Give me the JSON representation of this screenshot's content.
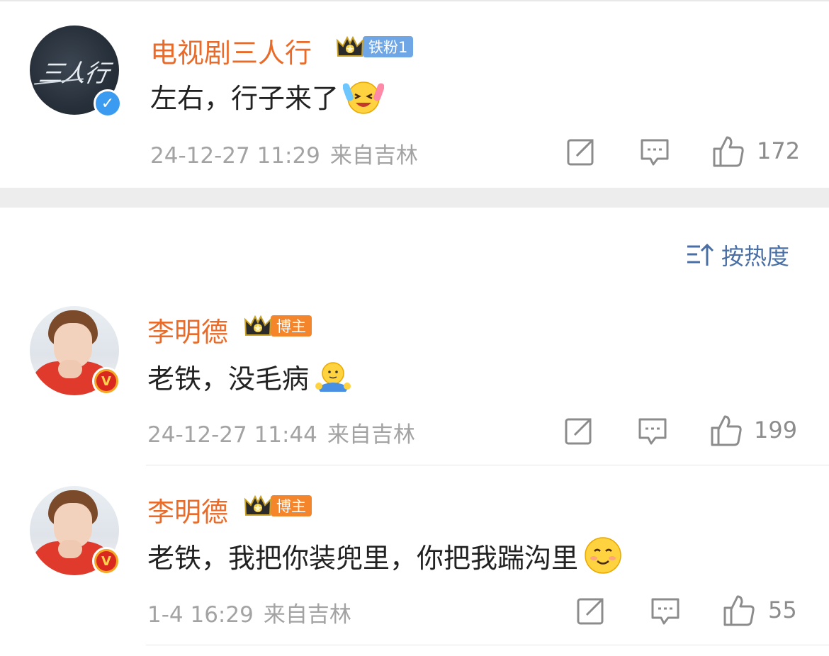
{
  "comments": [
    {
      "name": "电视剧三人行",
      "badge": "铁粉1",
      "avatar_text": "三人行",
      "text": "左右，行子来了",
      "emoji": "laughing-crying-emoji",
      "time": "24-12-27 11:29",
      "source": "来自吉林",
      "likes": "172"
    },
    {
      "name": "李明德",
      "badge": "博主",
      "text": "老铁，没毛病",
      "emoji": "hug-emoji",
      "time": "24-12-27 11:44",
      "source": "来自吉林",
      "likes": "199"
    },
    {
      "name": "李明德",
      "badge": "博主",
      "text": "老铁，我把你装兜里，你把我踹沟里",
      "emoji": "smile-emoji",
      "time": "1-4 16:29",
      "source": "来自吉林",
      "likes": "55"
    }
  ],
  "sort": {
    "label": "按热度",
    "icon": "sort-icon"
  },
  "colors": {
    "name": "#e96b2a",
    "fan_badge": "#6fa6e6",
    "host_badge": "#f5852a",
    "verified_blue": "#3a9bf0",
    "verified_gold": "#f5a623",
    "sort": "#4a6fa5"
  }
}
